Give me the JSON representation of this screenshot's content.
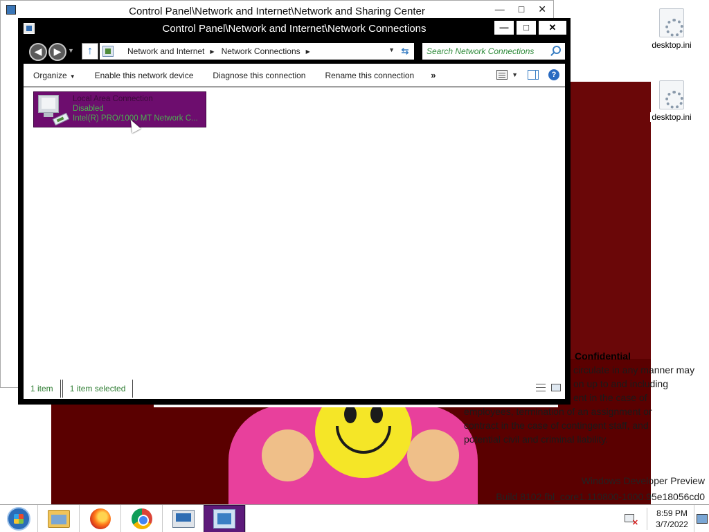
{
  "background_window": {
    "title": "Control Panel\\Network and Internet\\Network and Sharing Center",
    "controls": [
      "—",
      "□",
      "✕"
    ]
  },
  "window": {
    "title": "Control Panel\\Network and Internet\\Network Connections",
    "controls": {
      "minimize": "—",
      "maximize": "□",
      "close": "✕"
    }
  },
  "address": {
    "breadcrumbs": [
      "Network and Internet",
      "Network Connections"
    ],
    "search_placeholder": "Search Network Connections"
  },
  "commands": {
    "organize": "Organize",
    "enable": "Enable this network device",
    "diagnose": "Diagnose this connection",
    "rename": "Rename this connection",
    "more": "»"
  },
  "connection": {
    "name": "Local Area Connection",
    "status": "Disabled",
    "adapter": "Intel(R) PRO/1000 MT Network C..."
  },
  "status_bar": {
    "count": "1 item",
    "selected": "1 item selected"
  },
  "desktop": {
    "icons": [
      {
        "label": "desktop.ini"
      },
      {
        "label": "desktop.ini"
      }
    ],
    "wallpaper_text": {
      "title": "Confidential",
      "lines": [
        "circulate in any manner may",
        "on up to and including",
        "ent in the case of",
        "employees, termination of an assignment or",
        "contract in the case of contingent staff, and",
        "potential civil and criminal liability."
      ],
      "watermark_1": "Windows Developer Preview",
      "watermark_2": "Build 8102.fbl_core1.110800-1000.95e18056cd0"
    }
  },
  "taskbar": {
    "time": "8:59 PM",
    "date": "3/7/2022"
  },
  "colors": {
    "selection": "#6d0d6e",
    "status_text": "#4caf50",
    "wallpaper": "#5a0000"
  }
}
